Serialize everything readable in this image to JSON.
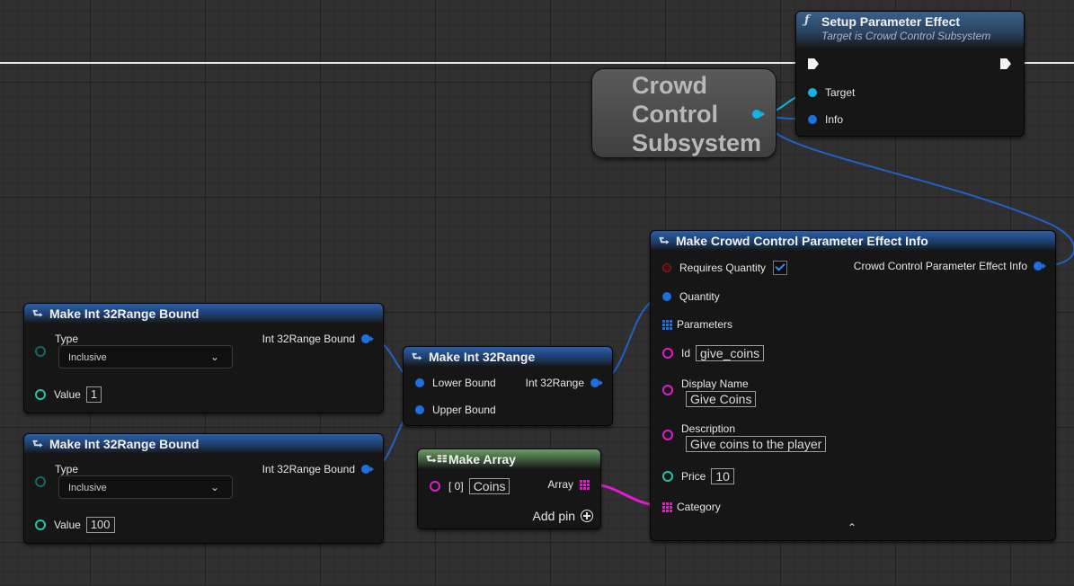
{
  "setup_node": {
    "title": "Setup Parameter Effect",
    "subtitle": "Target is Crowd Control Subsystem",
    "icon": "function-icon",
    "pins": {
      "target": "Target",
      "info": "Info"
    }
  },
  "variable_node": {
    "title": "Crowd\nControl\nSubsystem"
  },
  "bound_node_1": {
    "title": "Make Int 32Range Bound",
    "type_label": "Type",
    "type_value": "Inclusive",
    "output_label": "Int 32Range Bound",
    "value_label": "Value",
    "value": "1"
  },
  "bound_node_2": {
    "title": "Make Int 32Range Bound",
    "type_label": "Type",
    "type_value": "Inclusive",
    "output_label": "Int 32Range Bound",
    "value_label": "Value",
    "value": "100"
  },
  "range_node": {
    "title": "Make Int 32Range",
    "lower_label": "Lower Bound",
    "upper_label": "Upper Bound",
    "output_label": "Int 32Range"
  },
  "array_node": {
    "title": "Make Array",
    "index_label": "[ 0]",
    "item_value": "Coins",
    "output_label": "Array",
    "add_pin_label": "Add pin"
  },
  "effect_info_node": {
    "title": "Make Crowd Control Parameter Effect Info",
    "requires_quantity_label": "Requires Quantity",
    "requires_quantity_checked": true,
    "output_label": "Crowd Control Parameter Effect Info",
    "quantity_label": "Quantity",
    "parameters_label": "Parameters",
    "id_label": "Id",
    "id_value": "give_coins",
    "display_name_label": "Display Name",
    "display_name_value": "Give Coins",
    "description_label": "Description",
    "description_value": "Give coins to the player",
    "price_label": "Price",
    "price_value": "10",
    "category_label": "Category",
    "collapse_icon": "chevron-up-icon"
  },
  "colors": {
    "grid_bg": "#303030",
    "object_pin": "#12b4e8",
    "struct_pin": "#1e6fe0",
    "string_pin": "#e01bd0",
    "int_pin": "#1fc3a6",
    "wire_blue": "#1e63c8",
    "wire_pink": "#e01bd0"
  }
}
